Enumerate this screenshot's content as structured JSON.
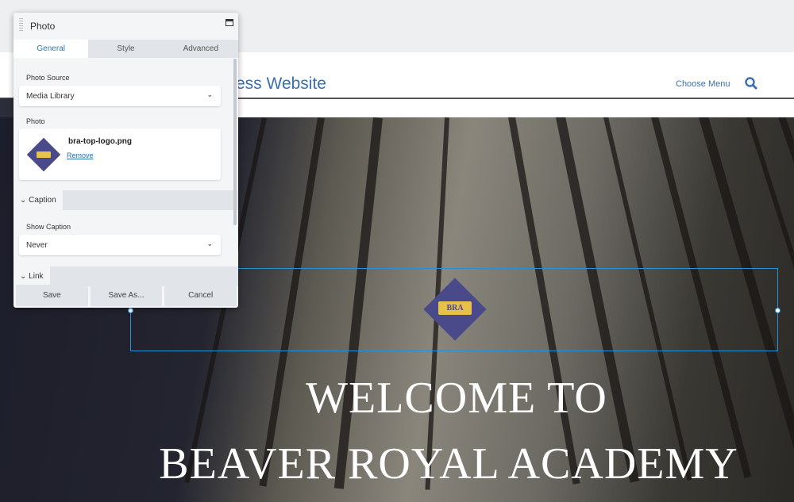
{
  "site": {
    "title": "ress Website",
    "menu": "Choose Menu",
    "search_icon": "search-icon"
  },
  "hero": {
    "line1": "WELCOME TO",
    "line2": "BEAVER ROYAL ACADEMY",
    "logo_text": "BRA"
  },
  "panel": {
    "title": "Photo",
    "tabs": [
      {
        "label": "General",
        "active": true
      },
      {
        "label": "Style"
      },
      {
        "label": "Advanced"
      }
    ],
    "photo_source": {
      "label": "Photo Source",
      "value": "Media Library"
    },
    "photo": {
      "label": "Photo",
      "filename": "bra-top-logo.png",
      "remove": "Remove"
    },
    "caption_section": "Caption",
    "show_caption": {
      "label": "Show Caption",
      "value": "Never"
    },
    "link_section": "Link",
    "buttons": {
      "save": "Save",
      "save_as": "Save As...",
      "cancel": "Cancel"
    }
  },
  "colors": {
    "accent": "#2a7ab0",
    "logo_bg": "#4a4a8a",
    "logo_gold": "#e8c14a",
    "selection": "#2a8fd0"
  }
}
